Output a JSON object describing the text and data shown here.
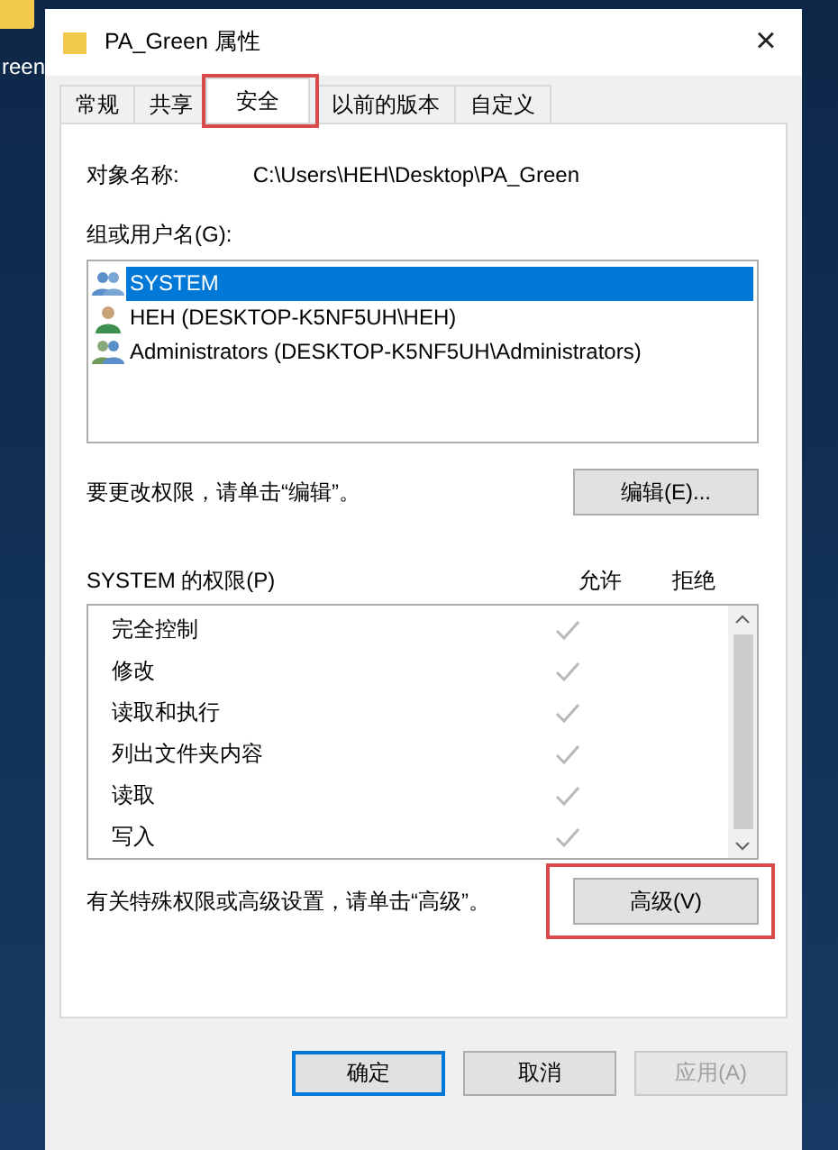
{
  "desktop": {
    "icon_label": "reen"
  },
  "window": {
    "title": "PA_Green 属性",
    "close": "×"
  },
  "tabs": [
    {
      "label": "常规",
      "selected": false,
      "highlighted": false
    },
    {
      "label": "共享",
      "selected": false,
      "highlighted": false
    },
    {
      "label": "安全",
      "selected": true,
      "highlighted": true
    },
    {
      "label": "以前的版本",
      "selected": false,
      "highlighted": false
    },
    {
      "label": "自定义",
      "selected": false,
      "highlighted": false
    }
  ],
  "object": {
    "label": "对象名称:",
    "value": "C:\\Users\\HEH\\Desktop\\PA_Green"
  },
  "users": {
    "label": "组或用户名(G):",
    "items": [
      {
        "name": "SYSTEM",
        "kind": "group",
        "selected": true
      },
      {
        "name": "HEH (DESKTOP-K5NF5UH\\HEH)",
        "kind": "user",
        "selected": false
      },
      {
        "name": "Administrators (DESKTOP-K5NF5UH\\Administrators)",
        "kind": "group",
        "selected": false
      }
    ]
  },
  "edit_hint": "要更改权限，请单击“编辑”。",
  "edit_button": {
    "label": "编辑(E)...",
    "highlighted": false
  },
  "permissions": {
    "label": "SYSTEM 的权限(P)",
    "allow_header": "允许",
    "deny_header": "拒绝",
    "rows": [
      {
        "name": "完全控制",
        "allow": true,
        "deny": false
      },
      {
        "name": "修改",
        "allow": true,
        "deny": false
      },
      {
        "name": "读取和执行",
        "allow": true,
        "deny": false
      },
      {
        "name": "列出文件夹内容",
        "allow": true,
        "deny": false
      },
      {
        "name": "读取",
        "allow": true,
        "deny": false
      },
      {
        "name": "写入",
        "allow": true,
        "deny": false
      }
    ]
  },
  "advanced_hint": "有关特殊权限或高级设置，请单击“高级”。",
  "advanced_button": {
    "label": "高级(V)",
    "highlighted": true
  },
  "buttons": [
    {
      "label": "确定",
      "kind": "default",
      "disabled": false
    },
    {
      "label": "取消",
      "kind": "normal",
      "disabled": false
    },
    {
      "label": "应用(A)",
      "kind": "normal",
      "disabled": true
    }
  ]
}
